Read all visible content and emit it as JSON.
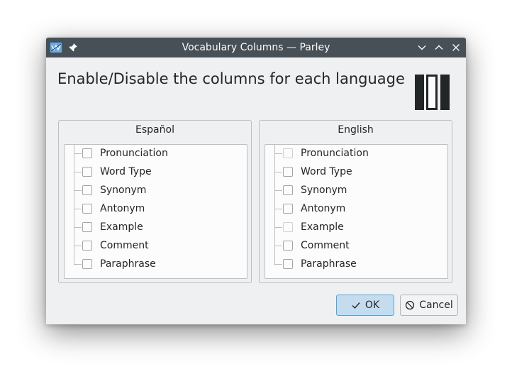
{
  "window": {
    "title": "Vocabulary Columns — Parley"
  },
  "header": {
    "text": "Enable/Disable the columns for each language"
  },
  "groups": {
    "left": {
      "title": "Español",
      "items": [
        {
          "label": "Pronunciation",
          "checked": false
        },
        {
          "label": "Word Type",
          "checked": false
        },
        {
          "label": "Synonym",
          "checked": false
        },
        {
          "label": "Antonym",
          "checked": false
        },
        {
          "label": "Example",
          "checked": false
        },
        {
          "label": "Comment",
          "checked": false
        },
        {
          "label": "Paraphrase",
          "checked": false
        }
      ]
    },
    "right": {
      "title": "English",
      "items": [
        {
          "label": "Pronunciation",
          "checked": false
        },
        {
          "label": "Word Type",
          "checked": false
        },
        {
          "label": "Synonym",
          "checked": false
        },
        {
          "label": "Antonym",
          "checked": false
        },
        {
          "label": "Example",
          "checked": false
        },
        {
          "label": "Comment",
          "checked": false
        },
        {
          "label": "Paraphrase",
          "checked": false
        }
      ]
    }
  },
  "buttons": {
    "ok": "OK",
    "cancel": "Cancel"
  },
  "icons": {
    "app": "parley-app-icon",
    "pin": "pin-icon",
    "minimize": "chevron-down-icon",
    "maximize": "chevron-up-icon",
    "close": "close-icon",
    "columns": "columns-icon",
    "ok": "checkmark-icon",
    "cancel": "cancel-icon"
  },
  "colors": {
    "titlebar": "#475057",
    "window_bg": "#eff0f1",
    "accent": "#4fa6d8",
    "ok_bg": "#c5dcee"
  }
}
